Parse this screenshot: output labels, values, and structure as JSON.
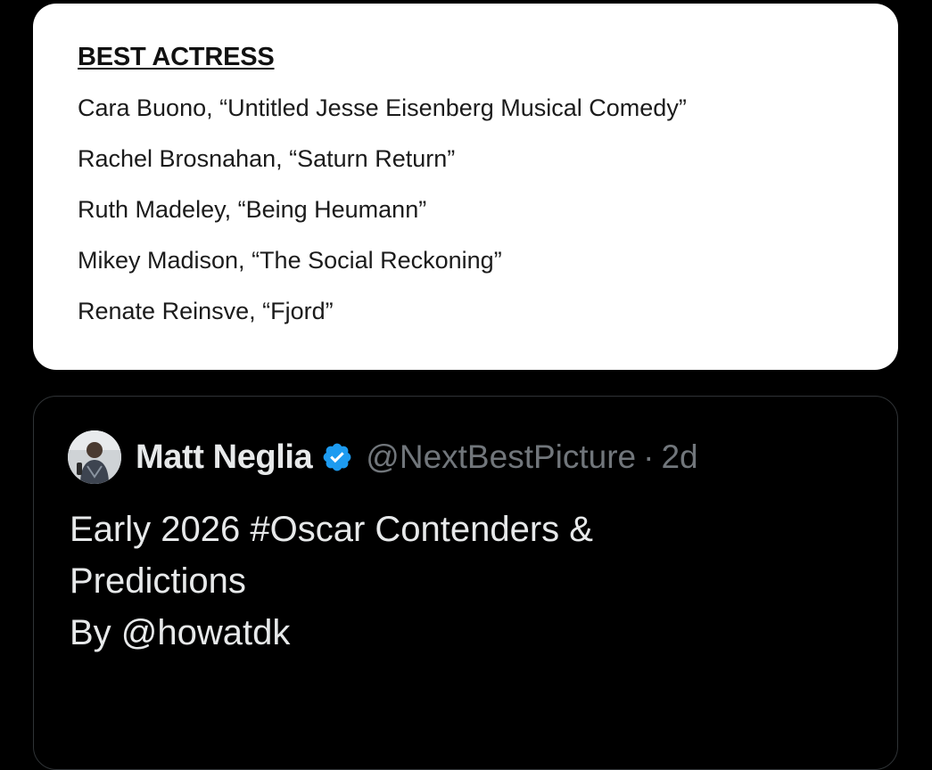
{
  "image_card": {
    "heading": "BEST ACTRESS",
    "nominees": [
      "Cara Buono, “Untitled Jesse Eisenberg Musical Comedy”",
      "Rachel Brosnahan, “Saturn Return”",
      "Ruth Madeley, “Being Heumann”",
      "Mikey Madison, “The Social Reckoning”",
      "Renate Reinsve, “Fjord”"
    ]
  },
  "quoted_tweet": {
    "author_name": "Matt Neglia",
    "handle": "@NextBestPicture",
    "separator": "·",
    "timestamp": "2d",
    "verified": true,
    "verified_color": "#1d9bf0",
    "avatar_icon": "avatar-photo",
    "body_lines": [
      "Early 2026 #Oscar Contenders &",
      "Predictions",
      "By @howatdk"
    ]
  },
  "colors": {
    "background": "#000000",
    "card_background": "#ffffff",
    "secondary_text": "#71767b",
    "primary_text": "#e7e9ea"
  }
}
